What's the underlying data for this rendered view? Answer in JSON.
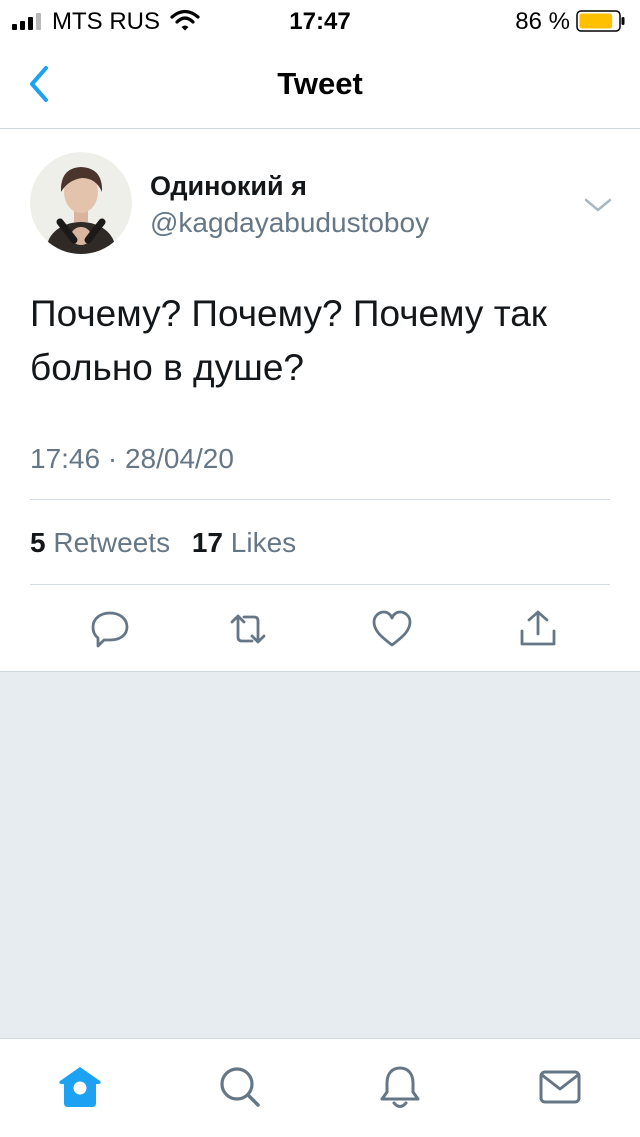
{
  "status_bar": {
    "carrier": "MTS RUS",
    "time": "17:47",
    "battery_percent": "86 %",
    "battery_level": 0.86,
    "battery_color": "#ffc000"
  },
  "nav": {
    "title": "Tweet",
    "back_icon": "chevron-left-icon",
    "accent_color": "#1da1f2"
  },
  "tweet": {
    "author": {
      "display_name": "Одинокий я",
      "handle": "@kagdayabudustoboy"
    },
    "text": "Почему? Почему? Почему так больно в душе?",
    "timestamp": "17:46 · 28/04/20",
    "stats": {
      "retweets_count": "5",
      "retweets_label": "Retweets",
      "likes_count": "17",
      "likes_label": "Likes"
    },
    "actions": [
      "reply-icon",
      "retweet-icon",
      "like-icon",
      "share-icon"
    ]
  },
  "tab_bar": {
    "tabs": [
      "home-icon",
      "search-icon",
      "notifications-icon",
      "messages-icon"
    ],
    "active": "home-icon"
  }
}
